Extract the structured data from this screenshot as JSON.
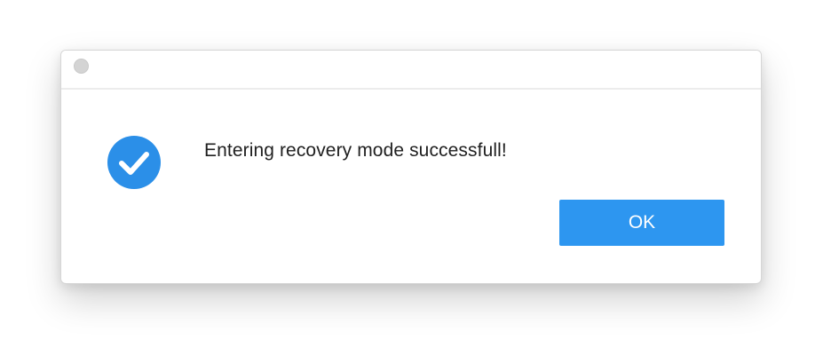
{
  "dialog": {
    "message": "Entering recovery mode successfull!",
    "ok_label": "OK",
    "icon": "checkmark-circle-icon",
    "colors": {
      "accent": "#2d96f0",
      "icon": "#2b8fe8",
      "text": "#1f1f1f",
      "close_dot": "#d4d4d4"
    }
  }
}
